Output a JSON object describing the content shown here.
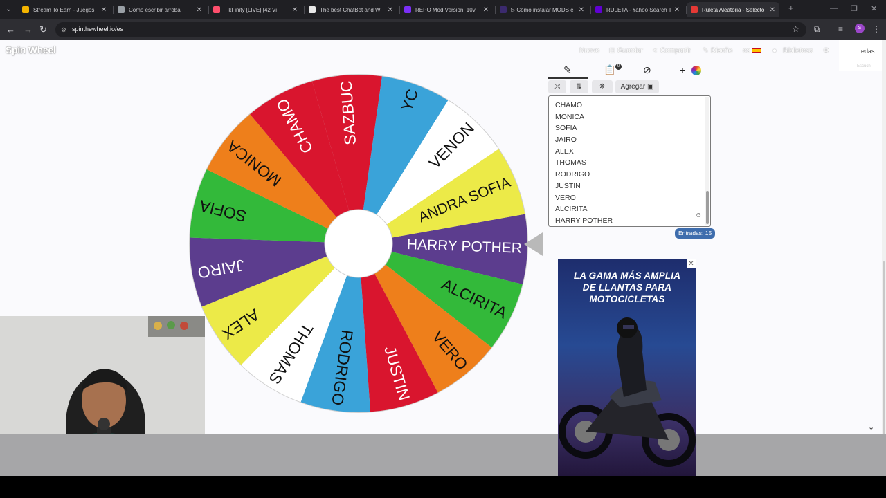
{
  "browser": {
    "tabs": [
      {
        "title": "Stream To Earn - Juegos",
        "icon_color": "#f4b400"
      },
      {
        "title": "Cómo escribir arroba",
        "icon_color": "#9aa0a6"
      },
      {
        "title": "TikFinity [LIVE] [42 Vi",
        "icon_color": "#ff4f6d"
      },
      {
        "title": "The best ChatBot and Wi",
        "icon_color": "#e8e8e8"
      },
      {
        "title": "REPO Mod Version: 10v",
        "icon_color": "#7b2ff7"
      },
      {
        "title": "▷ Cómo instalar MODS e",
        "icon_color": "#3b2a6e"
      },
      {
        "title": "RULETA - Yahoo Search T",
        "icon_color": "#6001d2"
      },
      {
        "title": "Ruleta Aleatoria - Selecto",
        "icon_color": "#e53935"
      }
    ],
    "new_tab_label": "+",
    "url": "spinthewheel.io/es",
    "profile_initial": "S"
  },
  "site": {
    "logo": "Spin Wheel",
    "nav": {
      "new": "Nuevo",
      "save": "Guardar",
      "share": "Compartir",
      "design": "Diseño",
      "lang": "es",
      "library": "Biblioteca"
    },
    "popup_text": "edas",
    "popup_subtext": "Escuch"
  },
  "wheel": {
    "segments": [
      {
        "label": "HARRY POTHER",
        "color": "#5c3d8e",
        "text_color": "#ffffff"
      },
      {
        "label": "ALCIRITA",
        "color": "#33b93a",
        "text_color": "#111111"
      },
      {
        "label": "VERO",
        "color": "#ee7f1b",
        "text_color": "#111111"
      },
      {
        "label": "JUSTIN",
        "color": "#d9152e",
        "text_color": "#ffffff"
      },
      {
        "label": "RODRIGO",
        "color": "#3aa3d9",
        "text_color": "#111111"
      },
      {
        "label": "THOMAS",
        "color": "#ffffff",
        "text_color": "#111111"
      },
      {
        "label": "ALEX",
        "color": "#ecea48",
        "text_color": "#111111"
      },
      {
        "label": "JAIRO",
        "color": "#5c3d8e",
        "text_color": "#ffffff"
      },
      {
        "label": "SOFIA",
        "color": "#33b93a",
        "text_color": "#111111"
      },
      {
        "label": "MONICA",
        "color": "#ee7f1b",
        "text_color": "#111111"
      },
      {
        "label": "CHAMO",
        "color": "#d9152e",
        "text_color": "#ffffff"
      },
      {
        "label": "SAZBUC",
        "color": "#d9152e",
        "text_color": "#ffffff"
      },
      {
        "label": "YC",
        "color": "#3aa3d9",
        "text_color": "#111111"
      },
      {
        "label": "VENON",
        "color": "#ffffff",
        "text_color": "#111111"
      },
      {
        "label": "ANDRA SOFIA",
        "color": "#ecea48",
        "text_color": "#111111"
      }
    ]
  },
  "editor": {
    "tabs": [
      "edit-icon",
      "clipboard-icon",
      "hide-icon",
      "add-color-icon"
    ],
    "clipboard_badge": "0",
    "add_label": "Agregar",
    "entries": [
      "CHAMO",
      "MONICA",
      "SOFIA",
      "JAIRO",
      "ALEX",
      "THOMAS",
      "RODRIGO",
      "JUSTIN",
      "VERO",
      "ALCIRITA",
      "HARRY POTHER"
    ],
    "entries_count": "Entradas: 15"
  },
  "ad": {
    "line1": "LA GAMA MÁS AMPLIA",
    "line2": "DE LLANTAS PARA",
    "line3": "MOTOCICLETAS",
    "close": "✕"
  }
}
